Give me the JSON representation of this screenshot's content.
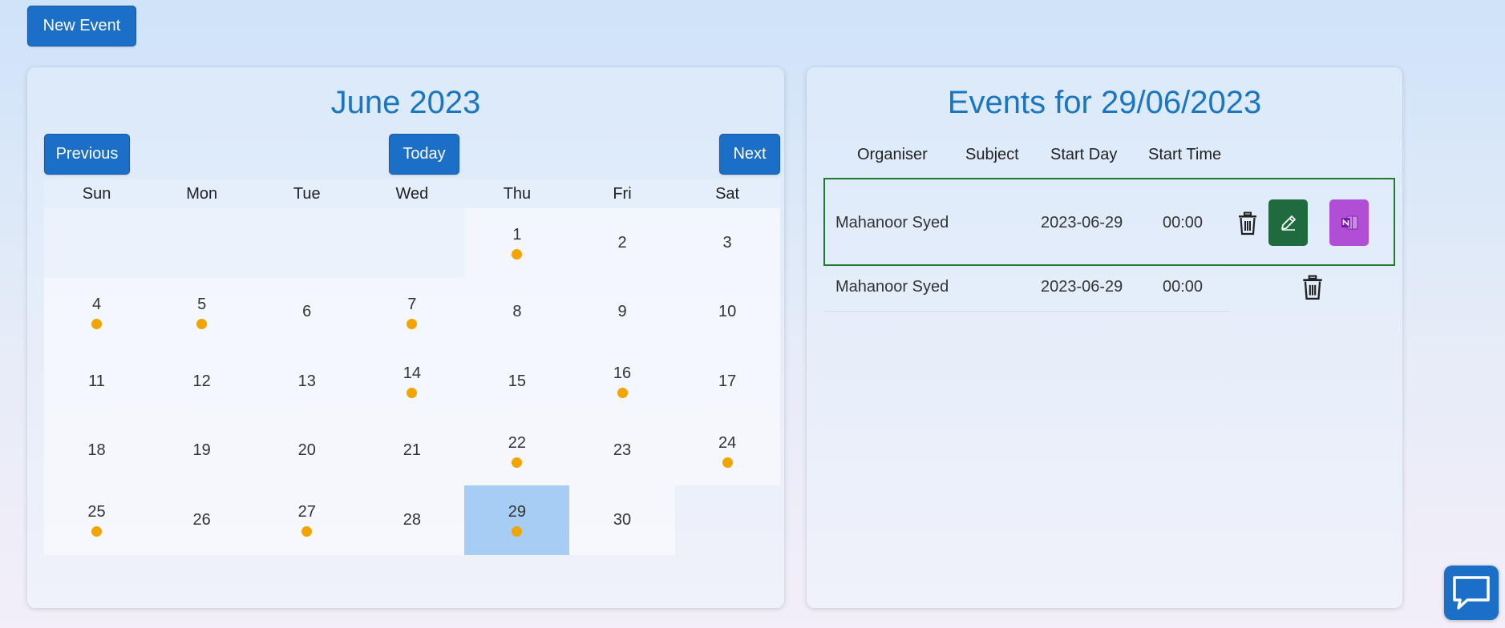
{
  "toolbar": {
    "new_event_label": "New Event"
  },
  "calendar": {
    "title": "June 2023",
    "prev_label": "Previous",
    "today_label": "Today",
    "next_label": "Next",
    "days_of_week": [
      "Sun",
      "Mon",
      "Tue",
      "Wed",
      "Thu",
      "Fri",
      "Sat"
    ],
    "weeks": [
      [
        {
          "day": ""
        },
        {
          "day": ""
        },
        {
          "day": ""
        },
        {
          "day": ""
        },
        {
          "day": "1",
          "event": true
        },
        {
          "day": "2"
        },
        {
          "day": "3"
        }
      ],
      [
        {
          "day": "4",
          "event": true
        },
        {
          "day": "5",
          "event": true
        },
        {
          "day": "6"
        },
        {
          "day": "7",
          "event": true
        },
        {
          "day": "8"
        },
        {
          "day": "9"
        },
        {
          "day": "10"
        }
      ],
      [
        {
          "day": "11"
        },
        {
          "day": "12"
        },
        {
          "day": "13"
        },
        {
          "day": "14",
          "event": true
        },
        {
          "day": "15"
        },
        {
          "day": "16",
          "event": true
        },
        {
          "day": "17"
        }
      ],
      [
        {
          "day": "18"
        },
        {
          "day": "19"
        },
        {
          "day": "20"
        },
        {
          "day": "21"
        },
        {
          "day": "22",
          "event": true
        },
        {
          "day": "23"
        },
        {
          "day": "24",
          "event": true
        }
      ],
      [
        {
          "day": "25",
          "event": true
        },
        {
          "day": "26"
        },
        {
          "day": "27",
          "event": true
        },
        {
          "day": "28"
        },
        {
          "day": "29",
          "event": true,
          "selected": true
        },
        {
          "day": "30"
        },
        {
          "day": "",
          "blank": true
        }
      ]
    ],
    "event_dot_color": "#f2a400",
    "selected_color": "#a6cdf3"
  },
  "events": {
    "title": "Events for 29/06/2023",
    "columns": [
      "Organiser",
      "Subject",
      "Start Day",
      "Start Time"
    ],
    "rows": [
      {
        "organiser": "Mahanoor Syed",
        "subject": "",
        "start_day": "2023-06-29",
        "start_time": "00:00"
      },
      {
        "organiser": "Mahanoor Syed",
        "subject": "",
        "start_day": "2023-06-29",
        "start_time": "00:00"
      }
    ],
    "selected_row_border": "#1e7a2e",
    "edit_color": "#1f6b3f",
    "onenote_color": "#b04fd6"
  },
  "icons": {
    "delete": "trash-icon",
    "edit": "pencil-icon",
    "onenote": "onenote-icon",
    "chat": "chat-icon"
  },
  "accent_color": "#1b6fc7"
}
